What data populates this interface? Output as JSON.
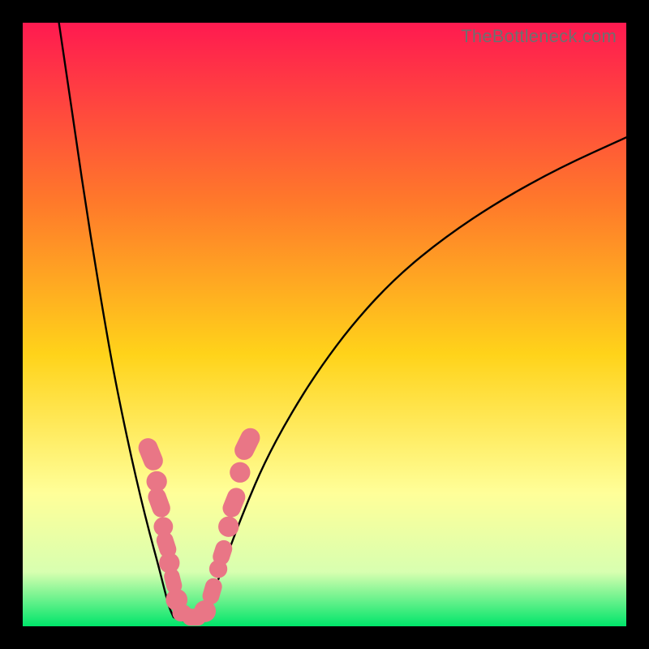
{
  "watermark": "TheBottleneck.com",
  "colors": {
    "gradient_top": "#ff1a50",
    "gradient_upper_mid": "#ff7a2a",
    "gradient_mid": "#ffd31a",
    "gradient_lower_mid": "#ffff99",
    "gradient_near_bottom": "#d8ffb0",
    "gradient_bottom": "#00e56a",
    "curve": "#000000",
    "marker_fill": "#e97686",
    "marker_stroke": "#e97686"
  },
  "chart_data": {
    "type": "line",
    "title": "",
    "xlabel": "",
    "ylabel": "",
    "xlim": [
      0,
      100
    ],
    "ylim": [
      0,
      100
    ],
    "series": [
      {
        "name": "left_curve",
        "x": [
          6.0,
          7.5,
          9.0,
          10.5,
          12.0,
          13.5,
          15.0,
          16.5,
          18.0,
          19.5,
          21.0,
          22.5,
          23.5,
          24.3,
          25.0
        ],
        "y": [
          100.0,
          90.0,
          79.5,
          69.5,
          60.0,
          51.0,
          42.5,
          35.0,
          28.0,
          21.5,
          15.5,
          10.0,
          6.0,
          3.0,
          1.5
        ]
      },
      {
        "name": "flat_bottom",
        "x": [
          25.0,
          26.0,
          27.0,
          28.0,
          29.0,
          30.0
        ],
        "y": [
          1.5,
          1.0,
          0.9,
          0.9,
          1.0,
          1.5
        ]
      },
      {
        "name": "right_curve",
        "x": [
          30.0,
          31.0,
          32.5,
          34.5,
          37.0,
          40.0,
          44.0,
          49.0,
          55.0,
          62.0,
          70.0,
          79.0,
          89.0,
          100.0
        ],
        "y": [
          1.5,
          4.0,
          8.0,
          13.5,
          20.0,
          27.0,
          34.5,
          42.5,
          50.5,
          58.0,
          64.5,
          70.5,
          76.0,
          81.0
        ]
      }
    ],
    "markers": [
      {
        "x": 21.2,
        "y": 28.5,
        "shape": "pill",
        "w": 3.2,
        "h": 5.5,
        "rot": -22
      },
      {
        "x": 22.2,
        "y": 24.0,
        "shape": "circle",
        "r": 1.7
      },
      {
        "x": 22.6,
        "y": 20.5,
        "shape": "pill",
        "w": 3.0,
        "h": 5.0,
        "rot": -20
      },
      {
        "x": 23.3,
        "y": 16.5,
        "shape": "circle",
        "r": 1.6
      },
      {
        "x": 23.8,
        "y": 13.5,
        "shape": "pill",
        "w": 2.8,
        "h": 4.4,
        "rot": -18
      },
      {
        "x": 24.3,
        "y": 10.5,
        "shape": "circle",
        "r": 1.7
      },
      {
        "x": 24.9,
        "y": 7.5,
        "shape": "pill",
        "w": 2.6,
        "h": 4.2,
        "rot": -14
      },
      {
        "x": 25.5,
        "y": 4.4,
        "shape": "circle",
        "r": 1.8
      },
      {
        "x": 26.4,
        "y": 2.2,
        "shape": "pill",
        "w": 3.2,
        "h": 2.8,
        "rot": 0
      },
      {
        "x": 28.4,
        "y": 1.5,
        "shape": "pill",
        "w": 4.0,
        "h": 2.8,
        "rot": 0
      },
      {
        "x": 30.2,
        "y": 2.5,
        "shape": "circle",
        "r": 1.8
      },
      {
        "x": 31.4,
        "y": 5.8,
        "shape": "pill",
        "w": 2.8,
        "h": 4.4,
        "rot": 16
      },
      {
        "x": 32.4,
        "y": 9.5,
        "shape": "circle",
        "r": 1.5
      },
      {
        "x": 33.1,
        "y": 12.2,
        "shape": "pill",
        "w": 2.8,
        "h": 4.2,
        "rot": 18
      },
      {
        "x": 34.1,
        "y": 16.5,
        "shape": "circle",
        "r": 1.7
      },
      {
        "x": 35.0,
        "y": 20.5,
        "shape": "pill",
        "w": 3.0,
        "h": 5.0,
        "rot": 22
      },
      {
        "x": 36.0,
        "y": 25.5,
        "shape": "circle",
        "r": 1.7
      },
      {
        "x": 37.2,
        "y": 30.2,
        "shape": "pill",
        "w": 3.2,
        "h": 5.5,
        "rot": 26
      }
    ]
  }
}
